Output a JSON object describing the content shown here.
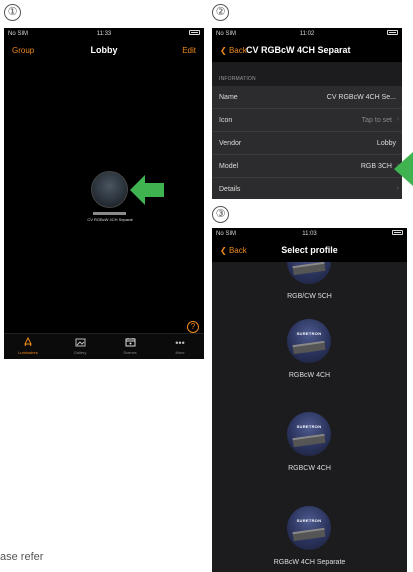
{
  "steps": [
    "①",
    "②",
    "③"
  ],
  "footnote": "ase refer",
  "screen1": {
    "status": {
      "carrier": "No SIM",
      "time": "11:33"
    },
    "nav": {
      "left": "Group",
      "title": "Lobby",
      "right": "Edit"
    },
    "luminaire": {
      "label": "CV RGBcW 4CH Separat"
    },
    "help": "?",
    "tabs": [
      {
        "label": "Luminaires",
        "icon": "luminaire-icon",
        "active": true
      },
      {
        "label": "Gallery",
        "icon": "gallery-icon",
        "active": false
      },
      {
        "label": "Scenes",
        "icon": "scenes-icon",
        "active": false
      },
      {
        "label": "More",
        "icon": "more-icon",
        "active": false
      }
    ]
  },
  "screen2": {
    "status": {
      "carrier": "No SIM",
      "time": "11:02"
    },
    "nav": {
      "left": "Back",
      "title": "CV RGBcW 4CH Separat"
    },
    "section": "INFORMATION",
    "rows": [
      {
        "key": "Name",
        "value": "CV RGBcW 4CH Se..."
      },
      {
        "key": "Icon",
        "value": "Tap to set"
      },
      {
        "key": "Vendor",
        "value": "Lobby"
      },
      {
        "key": "Model",
        "value": "RGB 3CH"
      },
      {
        "key": "Details",
        "value": ""
      }
    ]
  },
  "screen3": {
    "status": {
      "carrier": "No SIM",
      "time": "11:03"
    },
    "nav": {
      "left": "Back",
      "title": "Select profile"
    },
    "brand": "SURETRON",
    "profiles": [
      "RGB/CW 5CH",
      "RGBcW 4CH",
      "RGBCW 4CH",
      "RGBcW 4CH Separate"
    ]
  },
  "colors": {
    "accent": "#f08a1c",
    "arrow": "#3fb34f"
  }
}
